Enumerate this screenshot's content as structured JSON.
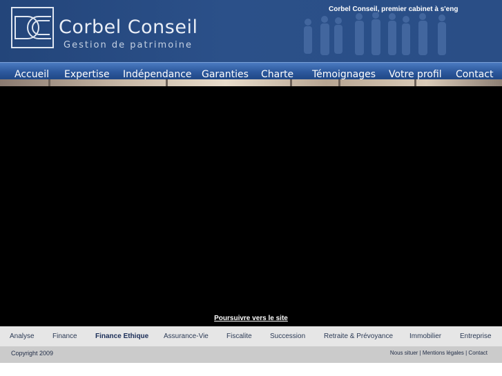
{
  "header": {
    "logo_name": "Corbel Conseil",
    "logo_tagline": "Gestion de patrimoine",
    "slogan": "Corbel Conseil, premier cabinet à s'eng"
  },
  "nav": {
    "items": [
      {
        "label": "Accueil"
      },
      {
        "label": "Expertise"
      },
      {
        "label": "Indépendance"
      },
      {
        "label": "Garanties"
      },
      {
        "label": "Charte"
      },
      {
        "label": "Témoignages"
      },
      {
        "label": "Votre profil"
      },
      {
        "label": "Contact"
      }
    ]
  },
  "intro": {
    "continue_link": "Poursuivre vers le site"
  },
  "subnav": {
    "items": [
      {
        "label": "Analyse"
      },
      {
        "label": "Finance"
      },
      {
        "label": "Finance Ethique",
        "active": true
      },
      {
        "label": "Assurance-Vie"
      },
      {
        "label": "Fiscalite"
      },
      {
        "label": "Succession"
      },
      {
        "label": "Retraite & Prévoyance"
      },
      {
        "label": "Immobilier"
      },
      {
        "label": "Entreprise"
      }
    ]
  },
  "footer": {
    "copyright": "Copyright 2009",
    "links": [
      "Nous situer",
      "Mentions légales",
      "Contact"
    ],
    "separator": " | "
  },
  "colors": {
    "header_bg": "#2b5089",
    "nav_bg": "#2e5a9f",
    "video_bg": "#000000",
    "subnav_bg": "#e6e6e6",
    "footer_bg": "#cbcbcb"
  }
}
